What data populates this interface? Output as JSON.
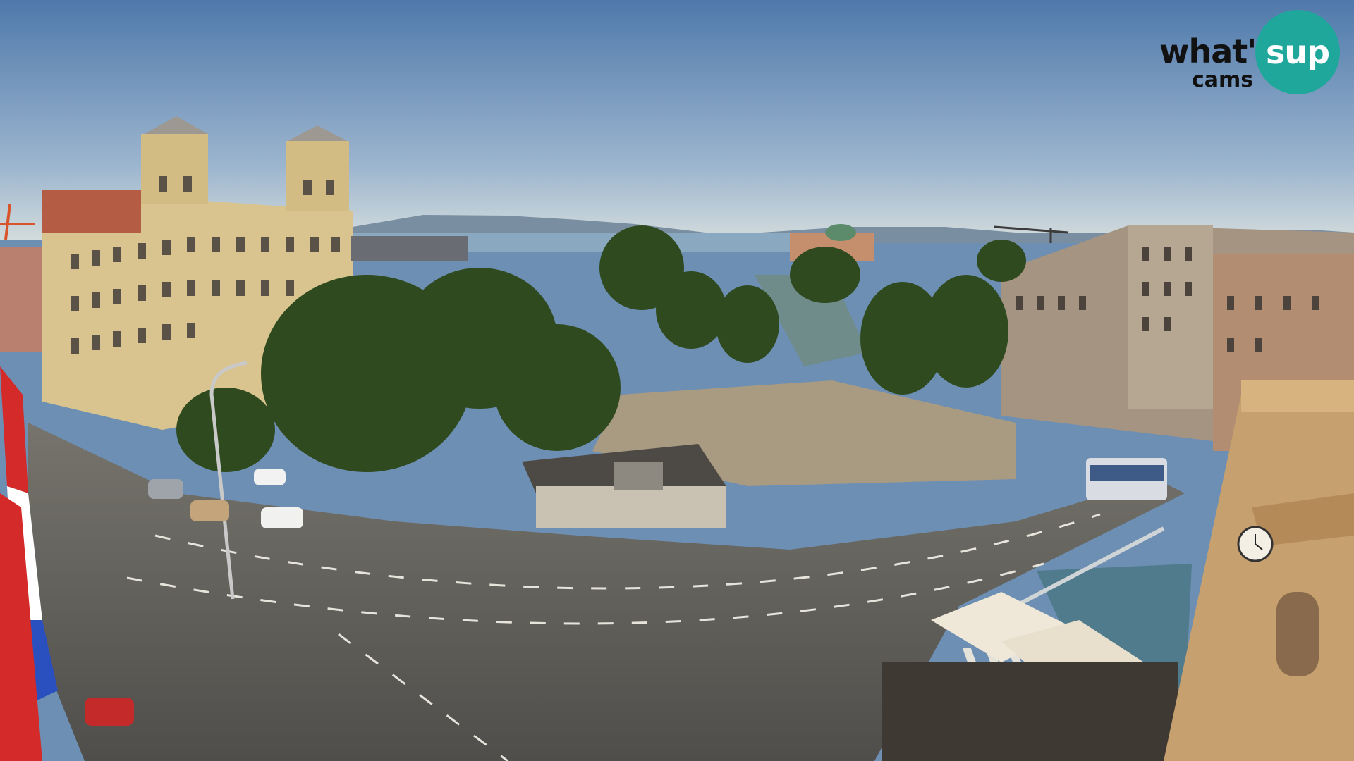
{
  "watermark": {
    "brand_main": "what'",
    "brand_bubble": "sup",
    "brand_sub": "cams",
    "bubble_color": "#1fa79b"
  },
  "scene": {
    "sky_color": "#5f87b5",
    "horizon_color": "#c9d6dc",
    "sea_color": "#8aa8bf",
    "road_color": "#5d5c58",
    "tree_color": "#2f4a1e",
    "building_color": "#d9c48f"
  },
  "clock": {
    "icon": "clock-face-icon"
  },
  "flag": {
    "colors": [
      "#d42a2a",
      "#ffffff",
      "#2a4fbf"
    ]
  }
}
